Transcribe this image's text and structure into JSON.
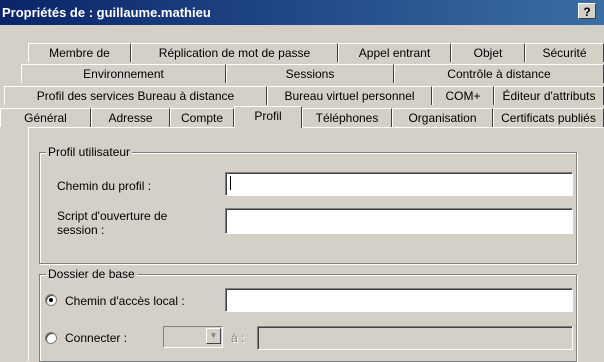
{
  "window": {
    "title": "Propriétés de : guillaume.mathieu",
    "help_label": "?"
  },
  "tabs": {
    "row1": [
      "Membre de",
      "Réplication de mot de passe",
      "Appel entrant",
      "Objet",
      "Sécurité"
    ],
    "row2": [
      "Environnement",
      "Sessions",
      "Contrôle à distance"
    ],
    "row3": [
      "Profil des services Bureau à distance",
      "Bureau virtuel personnel",
      "COM+",
      "Éditeur d'attributs"
    ],
    "row4": [
      "Général",
      "Adresse",
      "Compte",
      "Profil",
      "Téléphones",
      "Organisation",
      "Certificats publiés"
    ],
    "active": "Profil"
  },
  "profile_group": {
    "legend": "Profil utilisateur",
    "profile_path_label": "Chemin du profil :",
    "profile_path_value": "",
    "logon_script_label": "Script d'ouverture de session :",
    "logon_script_value": ""
  },
  "home_group": {
    "legend": "Dossier de base",
    "local_path_label": "Chemin d'accès local :",
    "local_path_value": "",
    "local_path_selected": true,
    "connect_label": "Connecter :",
    "connect_drive": "",
    "to_label": "à :",
    "to_value": ""
  }
}
